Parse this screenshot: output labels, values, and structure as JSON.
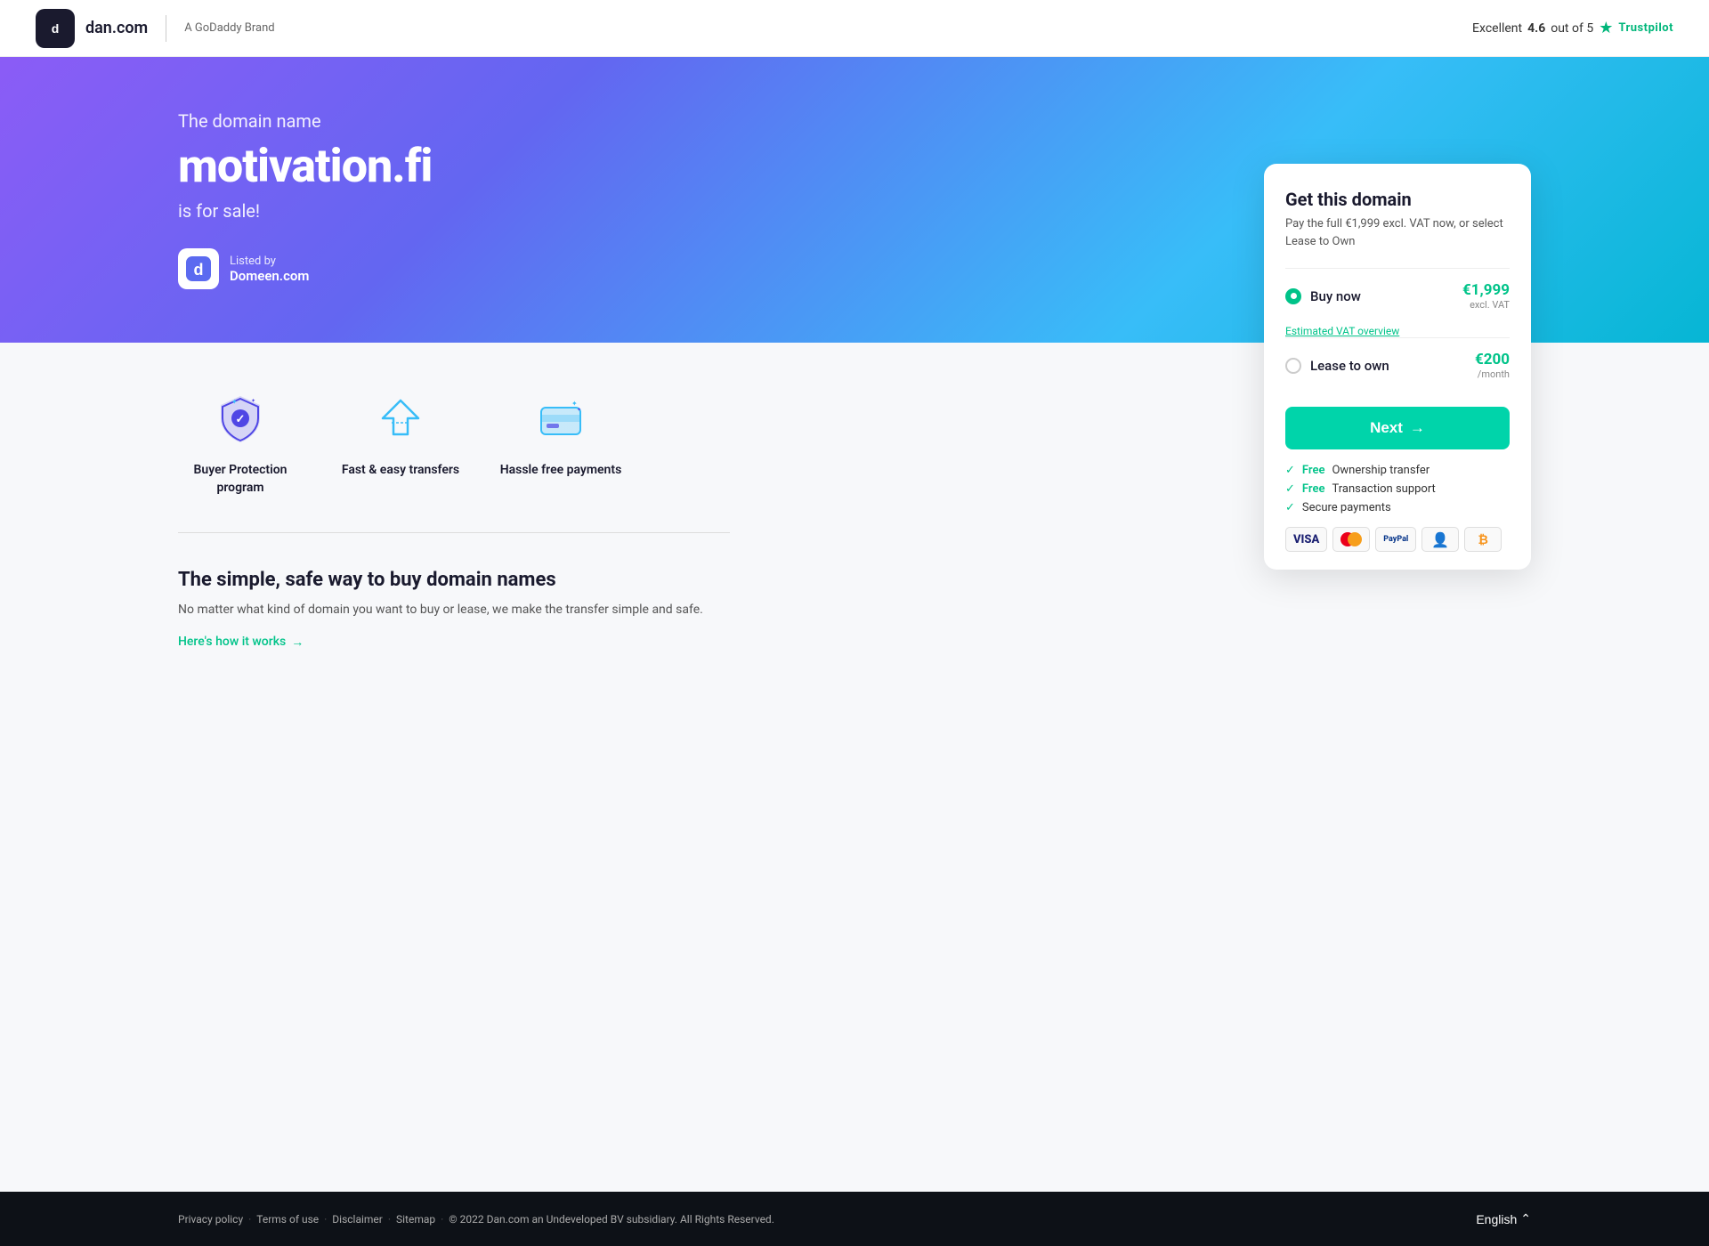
{
  "header": {
    "logo_text": "dan.com",
    "logo_icon": "d",
    "godaddy_brand": "A GoDaddy Brand",
    "trustpilot_label": "Excellent",
    "trustpilot_score": "4.6",
    "trustpilot_outof": "out of 5",
    "trustpilot_brand": "Trustpilot"
  },
  "hero": {
    "subtitle": "The domain name",
    "domain": "motivation.fi",
    "sale_text": "is for sale!",
    "listed_by_label": "Listed by",
    "listed_by_name": "Domeen.com",
    "listed_logo": "d"
  },
  "card": {
    "title": "Get this domain",
    "subtitle": "Pay the full €1,999 excl. VAT now, or select Lease to Own",
    "buy_now_label": "Buy now",
    "buy_now_price": "€1,999",
    "buy_now_price_sub": "excl. VAT",
    "vat_link": "Estimated VAT overview",
    "lease_label": "Lease to own",
    "lease_price": "€200",
    "lease_price_sub": "/month",
    "next_label": "Next",
    "features": [
      {
        "check": "Free",
        "text": "Ownership transfer"
      },
      {
        "check": "Free",
        "text": "Transaction support"
      },
      {
        "check": "",
        "text": "Secure payments"
      }
    ],
    "payment_methods": [
      "VISA",
      "MC",
      "PayPal",
      "Escrow",
      "BTC"
    ]
  },
  "features": [
    {
      "icon": "shield",
      "label": "Buyer Protection program"
    },
    {
      "icon": "transfer",
      "label": "Fast & easy transfers"
    },
    {
      "icon": "payment",
      "label": "Hassle free payments"
    }
  ],
  "info": {
    "title": "The simple, safe way to buy domain names",
    "text": "No matter what kind of domain you want to buy or lease, we make the transfer simple and safe.",
    "how_works": "Here's how it works"
  },
  "footer": {
    "links": [
      {
        "text": "Privacy policy"
      },
      {
        "text": "Terms of use"
      },
      {
        "text": "Disclaimer"
      },
      {
        "text": "Sitemap"
      }
    ],
    "copyright": "© 2022 Dan.com an Undeveloped BV subsidiary. All Rights Reserved.",
    "language": "English"
  }
}
